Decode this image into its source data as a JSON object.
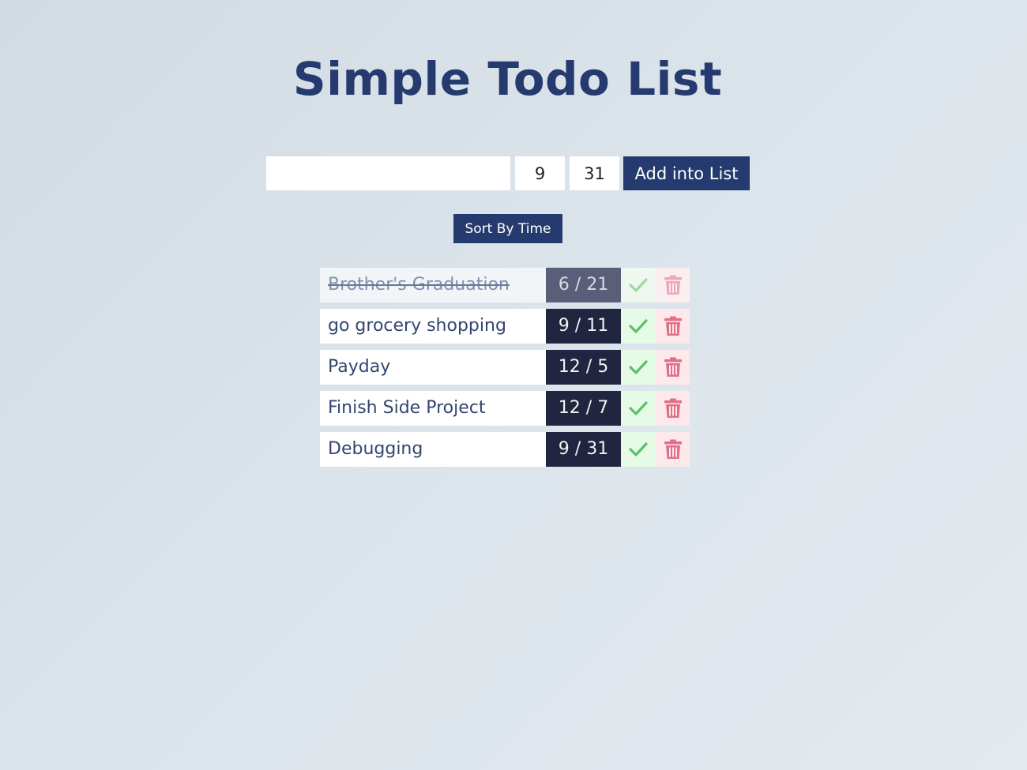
{
  "title": "Simple Todo List",
  "form": {
    "text_value": "",
    "month_value": "9",
    "day_value": "31",
    "add_label": "Add into List"
  },
  "sort_label": "Sort By Time",
  "todos": [
    {
      "text": "Brother's Graduation",
      "date": "6 / 21",
      "completed": true
    },
    {
      "text": "go grocery shopping",
      "date": "9 / 11",
      "completed": false
    },
    {
      "text": "Payday",
      "date": "12 / 5",
      "completed": false
    },
    {
      "text": "Finish Side Project",
      "date": "12 / 7",
      "completed": false
    },
    {
      "text": "Debugging",
      "date": "9 / 31",
      "completed": false
    }
  ],
  "icons": {
    "complete": "check-icon",
    "delete": "trash-icon"
  },
  "colors": {
    "primary": "#253a6e",
    "date_bg": "#222540",
    "check": "#5cbf6a",
    "trash": "#e0708a"
  }
}
